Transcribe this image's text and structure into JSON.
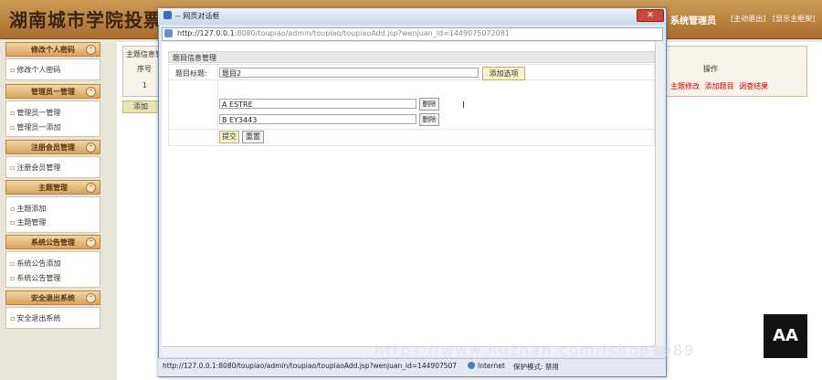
{
  "header": {
    "site_title": "湖南城市学院投票系",
    "role_label": "系统管理员",
    "logout_label": "[主动退出]",
    "home_label": "[显示主框架]"
  },
  "sidebar": {
    "sections": [
      {
        "title": "修改个人密码",
        "items": [
          "修改个人密码"
        ]
      },
      {
        "title": "管理员一管理",
        "items": [
          "管理员一管理",
          "管理员一添加"
        ]
      },
      {
        "title": "注册会员管理",
        "items": [
          "注册会员管理"
        ]
      },
      {
        "title": "主题管理",
        "items": [
          "主题添加",
          "主题管理"
        ]
      },
      {
        "title": "系统公告管理",
        "items": [
          "系统公告添加",
          "系统公告管理"
        ]
      },
      {
        "title": "安全退出系统",
        "items": [
          "安全退出系统"
        ]
      }
    ]
  },
  "main": {
    "breadcrumb": "主题信息管",
    "columns": {
      "seq": "序号",
      "ops": "操作"
    },
    "row1": {
      "seq": "1",
      "ops": [
        "主题修改",
        "添加题目",
        "调查结果"
      ]
    },
    "add_button": "添加"
  },
  "dialog": {
    "title": "-- 网页对话框",
    "close": "✕",
    "address_host": "http://127.0.0.1",
    "address_rest": ":8080/toupiao/admin/toupiao/toupiaoAdd.jsp?wenjuan_id=1449075072081",
    "form_header": "题目信息管理",
    "title_label": "题目标题:",
    "title_value": "题目2",
    "add_option_button": "添加选项",
    "options": [
      {
        "value": "A ESTRE",
        "delete_label": "删除"
      },
      {
        "value": "B EY3443",
        "delete_label": "删除"
      }
    ],
    "submit_button": "提交",
    "reset_button": "重置",
    "status_url": "http://127.0.0.1:8080/toupiao/admin/toupiao/toupiaoAdd.jsp?wenjuan_id=144907507",
    "status_zone": "Internet",
    "status_mode": "保护模式: 禁用"
  },
  "overlay": {
    "watermark": "https://www.huzhan.com/ishop3989",
    "logo_text": "AA"
  }
}
